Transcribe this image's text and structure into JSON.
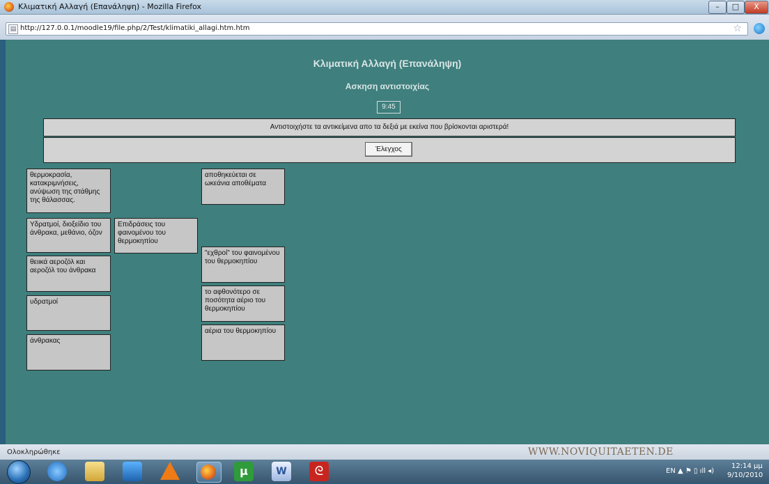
{
  "window": {
    "title": "Κλιματική Αλλαγή (Επανάληψη) - Mozilla Firefox",
    "minimize": "–",
    "maximize": "□",
    "close": "X"
  },
  "address_bar": {
    "url": "http://127.0.0.1/moodle19/file.php/2/Test/klimatiki_allagi.htm.htm",
    "bookmark_star": "☆"
  },
  "page": {
    "title": "Κλιματική Αλλαγή (Επανάληψη)",
    "subtitle": "Ασκηση αντιστοιχίας",
    "timer": "9:45",
    "instruction": "Αντιστοιχήστε τα αντικείμενα απο τα δεξιά με εκείνα που βρίσκονται αριστερά!",
    "check_button": "Έλεγχος",
    "left_items": [
      "θερμοκρασία, κατακριμνήσεις, ανύψωση της στάθμης της θάλασσας.",
      "Υδρατμοί, διοξείδιο του άνθρακα, μεθάνιο, όζον",
      "θειικά αεροζόλ και αεροζόλ του άνθρακα",
      "υδρατμοί",
      "άνθρακας"
    ],
    "middle_item": "Επιδράσεις του φαινομένου του θερμοκηπίου",
    "right_items": [
      "αποθηκεύεται σε ωκεάνια αποθέματα",
      "\"εχθροί\" του φαινομένου του θερμοκηπίου",
      "το αφθονότερο σε ποσότητα αέριο του θερμοκηπίου",
      "αέρια του θερμοκηπίου"
    ]
  },
  "status_bar": {
    "text": "Ολοκληρώθηκε",
    "watermark": "WWW.NOVIQUITAETEN.DE"
  },
  "taskbar": {
    "utorrent_glyph": "µ",
    "word_glyph": "W",
    "acrobat_glyph": "ᘓ",
    "tray": "EN   ▲   ⚑   ▯   ıll   ◂)",
    "time": "12:14 μμ",
    "date": "9/10/2010"
  }
}
